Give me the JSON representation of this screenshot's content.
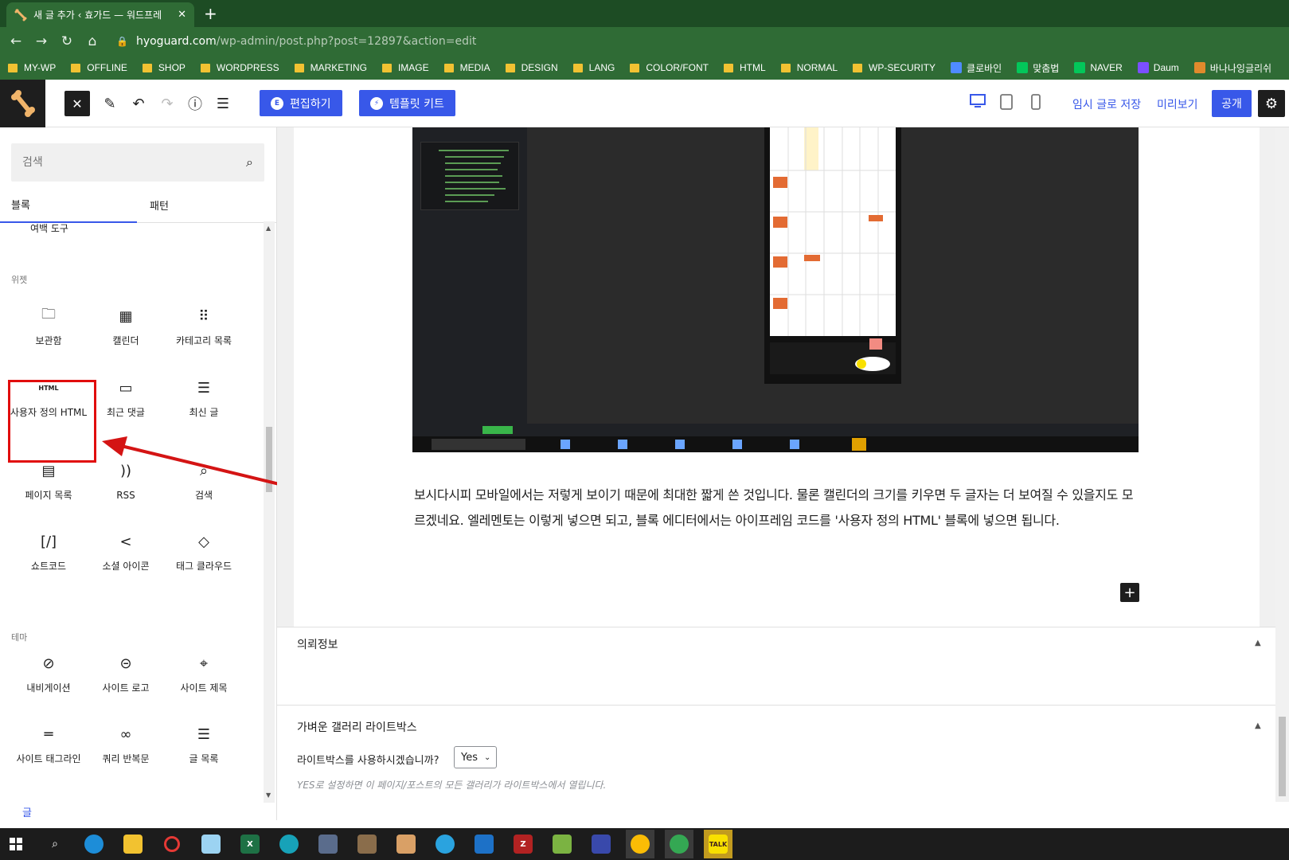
{
  "browser": {
    "tab_title": "새 글 추가 ‹ 효가드 — 워드프레",
    "url_host": "hyoguard.com",
    "url_path": "/wp-admin/post.php?post=12897&action=edit",
    "bookmarks": [
      {
        "label": "MY-WP",
        "type": "folder"
      },
      {
        "label": "OFFLINE",
        "type": "folder"
      },
      {
        "label": "SHOP",
        "type": "folder"
      },
      {
        "label": "WORDPRESS",
        "type": "folder"
      },
      {
        "label": "MARKETING",
        "type": "folder"
      },
      {
        "label": "IMAGE",
        "type": "folder"
      },
      {
        "label": "MEDIA",
        "type": "folder"
      },
      {
        "label": "DESIGN",
        "type": "folder"
      },
      {
        "label": "LANG",
        "type": "folder"
      },
      {
        "label": "COLOR/FONT",
        "type": "folder"
      },
      {
        "label": "HTML",
        "type": "folder"
      },
      {
        "label": "NORMAL",
        "type": "folder"
      },
      {
        "label": "WP-SECURITY",
        "type": "folder"
      },
      {
        "label": "클로바인",
        "type": "site"
      },
      {
        "label": "맞춤법",
        "type": "site"
      },
      {
        "label": "NAVER",
        "type": "site"
      },
      {
        "label": "Daum",
        "type": "site"
      },
      {
        "label": "바나나잉글리쉬",
        "type": "site"
      }
    ]
  },
  "header": {
    "edit_button": "편집하기",
    "template_kit_button": "템플릿 키트",
    "save_draft": "임시 글로 저장",
    "preview": "미리보기",
    "publish": "공개"
  },
  "inserter": {
    "search_placeholder": "검색",
    "tab_blocks": "블록",
    "tab_patterns": "패턴",
    "partial_block": "여백 도구",
    "category_widgets": "위젯",
    "category_theme": "테마",
    "widgets": [
      {
        "label": "보관함",
        "icon": "archive-icon"
      },
      {
        "label": "캘린더",
        "icon": "calendar-icon"
      },
      {
        "label": "카테고리 목록",
        "icon": "categories-icon"
      },
      {
        "label": "사용자 정의 HTML",
        "icon": "html-icon",
        "icon_text": "HTML"
      },
      {
        "label": "최근 댓글",
        "icon": "comment-icon"
      },
      {
        "label": "최신 글",
        "icon": "latest-posts-icon"
      },
      {
        "label": "페이지 목록",
        "icon": "page-list-icon"
      },
      {
        "label": "RSS",
        "icon": "rss-icon"
      },
      {
        "label": "검색",
        "icon": "search-icon"
      },
      {
        "label": "쇼트코드",
        "icon": "shortcode-icon",
        "icon_text": "[/]"
      },
      {
        "label": "소셜 아이콘",
        "icon": "share-icon"
      },
      {
        "label": "태그 클라우드",
        "icon": "tag-icon"
      }
    ],
    "theme": [
      {
        "label": "내비게이션",
        "icon": "navigation-icon"
      },
      {
        "label": "사이트 로고",
        "icon": "site-logo-icon"
      },
      {
        "label": "사이트 제목",
        "icon": "map-pin-icon"
      },
      {
        "label": "사이트 태그라인",
        "icon": "tagline-icon"
      },
      {
        "label": "쿼리 반복문",
        "icon": "loop-icon"
      },
      {
        "label": "글 목록",
        "icon": "post-list-icon"
      }
    ],
    "status": "글"
  },
  "content": {
    "paragraph": "보시다시피 모바일에서는 저렇게 보이기 때문에 최대한 짧게 쓴 것입니다. 물론 캘린더의 크기를 키우면 두 글자는 더 보여질 수 있을지도 모르겠네요. 엘레멘토는 이렇게 넣으면 되고, 블록 에디터에서는 아이프레임 코드를 '사용자 정의 HTML' 블록에 넣으면 됩니다."
  },
  "metaboxes": {
    "box1_title": "의뢰정보",
    "box2_title": "가벼운 갤러리 라이트박스",
    "lightbox_question": "라이트박스를 사용하시겠습니까?",
    "lightbox_value": "Yes",
    "lightbox_help": "YES로 설정하면 이 페이지/포스트의 모든 갤러리가 라이트박스에서 열립니다."
  },
  "colors": {
    "accent": "#3858e9",
    "highlight": "#e10d0d",
    "chrome": "#2f6b35"
  }
}
